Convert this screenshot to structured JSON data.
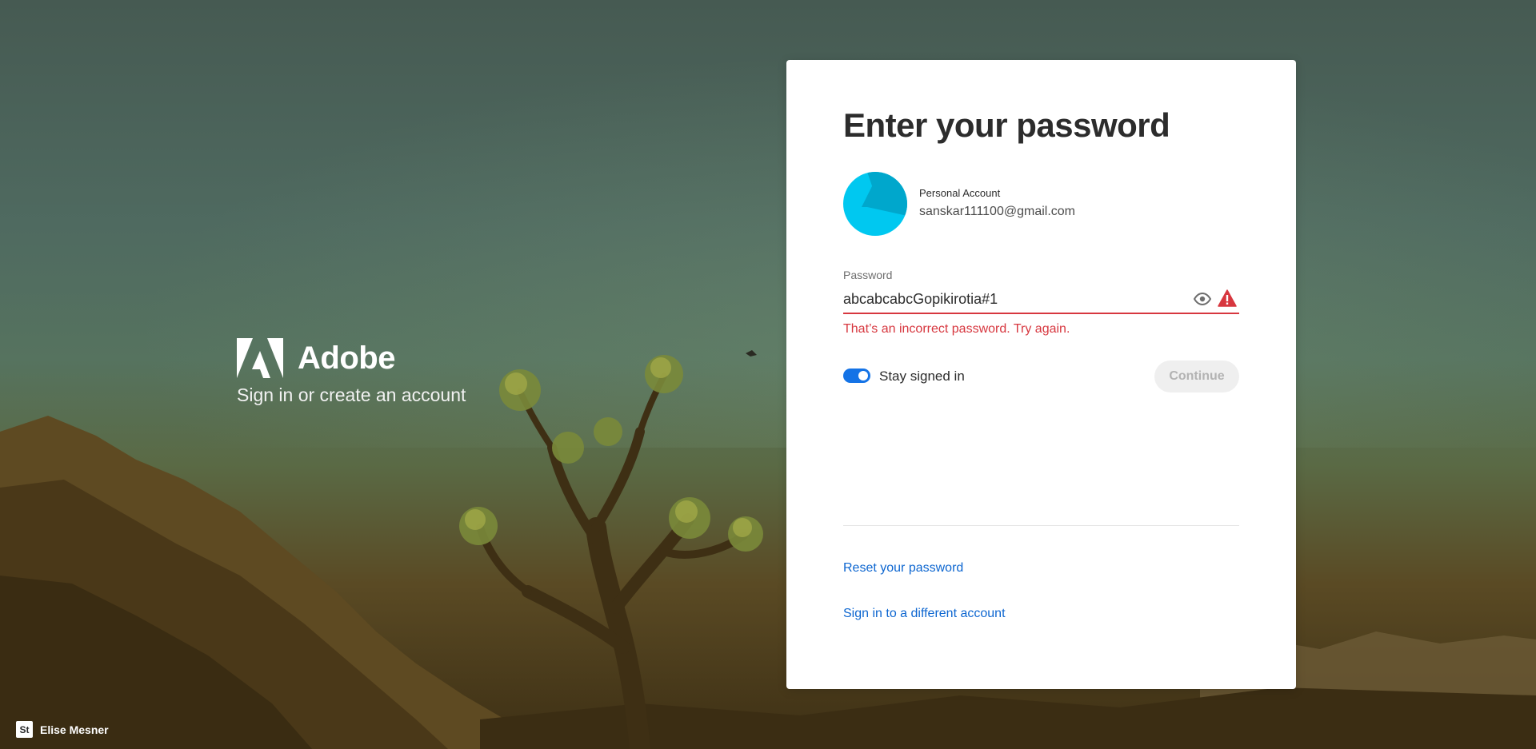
{
  "brand": {
    "name": "Adobe",
    "tagline": "Sign in or create an account"
  },
  "credit": {
    "badge": "St",
    "name": "Elise Mesner"
  },
  "card": {
    "title": "Enter your password",
    "account": {
      "type": "Personal Account",
      "email": "sanskar111100@gmail.com"
    },
    "password": {
      "label": "Password",
      "value": "abcabcabcGopikirotia#1",
      "error": "That’s an incorrect password. Try again."
    },
    "stay_signed_in": {
      "label": "Stay signed in",
      "checked": true
    },
    "continue_label": "Continue",
    "links": {
      "reset": "Reset your password",
      "different_account": "Sign in to a different account"
    }
  },
  "colors": {
    "accent": "#1473e6",
    "link": "#0d66d0",
    "error": "#d7373f",
    "avatar": "#00c8f0"
  },
  "icons": {
    "password_toggle": "eye-icon",
    "password_error": "alert-icon"
  }
}
